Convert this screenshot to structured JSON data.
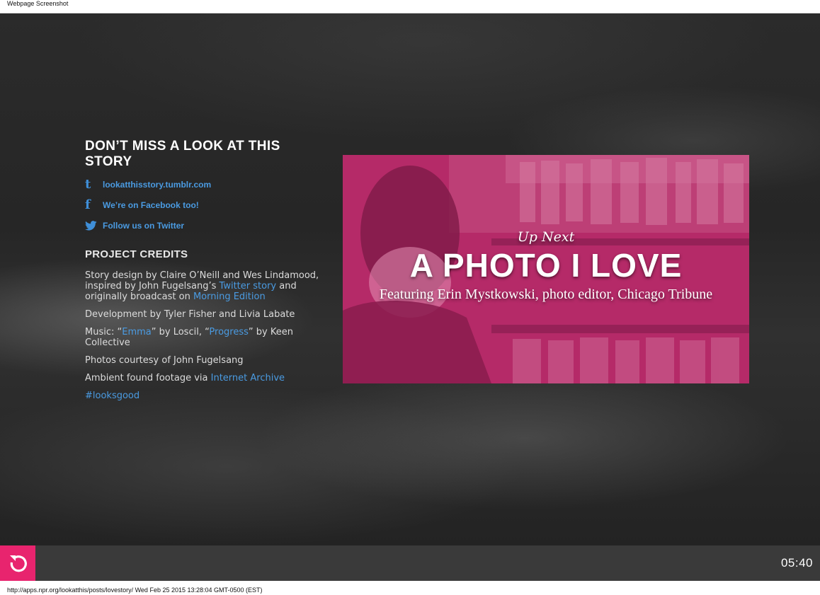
{
  "capture": {
    "title": "Webpage Screenshot",
    "footer": "http://apps.npr.org/lookatthis/posts/lovestory/ Wed Feb 25 2015 13:28:04 GMT-0500 (EST)"
  },
  "follow": {
    "heading": "DON’T MISS A LOOK AT THIS STORY",
    "links": [
      {
        "icon": "tumblr-icon",
        "glyph": "t",
        "label": "lookatthisstory.tumblr.com"
      },
      {
        "icon": "facebook-icon",
        "glyph": "f",
        "label": "We’re on Facebook too!"
      },
      {
        "icon": "twitter-icon",
        "glyph": "",
        "label": "Follow us on Twitter"
      }
    ]
  },
  "credits": {
    "heading": "PROJECT CREDITS",
    "line1": {
      "before": "Story design by Claire O’Neill and Wes Lindamood, inspired by John Fugelsang’s ",
      "link1": "Twitter story",
      "middle": " and originally broadcast on ",
      "link2": "Morning Edition"
    },
    "development": "Development by Tyler Fisher and Livia Labate",
    "music": {
      "before": "Music: “",
      "link1": "Emma",
      "middle": "” by Loscil, “",
      "link2": "Progress",
      "after": "” by Keen Collective"
    },
    "photos": "Photos courtesy of John Fugelsang",
    "footage": {
      "before": "Ambient found footage via ",
      "link": "Internet Archive"
    },
    "hashtag": "#looksgood"
  },
  "next": {
    "label": "Up Next",
    "title": "A PHOTO I LOVE",
    "subtitle": "Featuring Erin Mystkowski, photo editor, Chicago Tribune"
  },
  "player": {
    "replay_icon": "replay-icon",
    "time": "05:40"
  },
  "colors": {
    "accent": "#e8246e",
    "link": "#4a9be2",
    "card_tint": "#b8286a",
    "background": "#2a2a2a",
    "controls_bar": "#3a3a3a"
  }
}
